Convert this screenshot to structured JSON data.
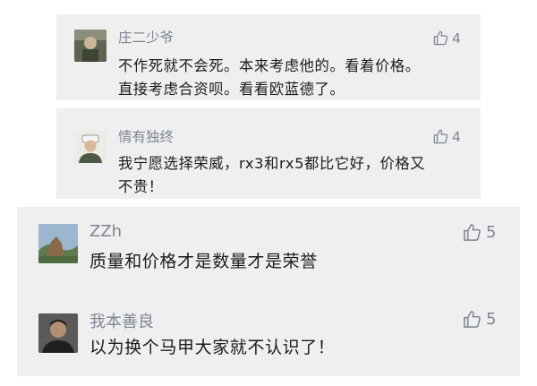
{
  "comments": [
    {
      "username": "庄二少爷",
      "likes": "4",
      "text_lines": [
        "不作死就不会死。本来考虑他的。看着价格。",
        "直接考虑合资呗。看看欧蓝德了。"
      ]
    },
    {
      "username": "情有独终",
      "likes": "4",
      "text_lines": [
        "我宁愿选择荣威，rx3和rx5都比它好，价格又",
        "不贵！"
      ]
    },
    {
      "username": "ZZh",
      "likes": "5",
      "text_lines": [
        "质量和价格才是数量才是荣誉"
      ]
    },
    {
      "username": "我本善良",
      "likes": "5",
      "text_lines": [
        "以为换个马甲大家就不认识了！"
      ]
    }
  ],
  "icons": {
    "like": "thumbs-up-icon"
  },
  "colors": {
    "card_background": "#efeff0",
    "meta_gray": "#7e8693",
    "text": "#1b1b1b"
  }
}
